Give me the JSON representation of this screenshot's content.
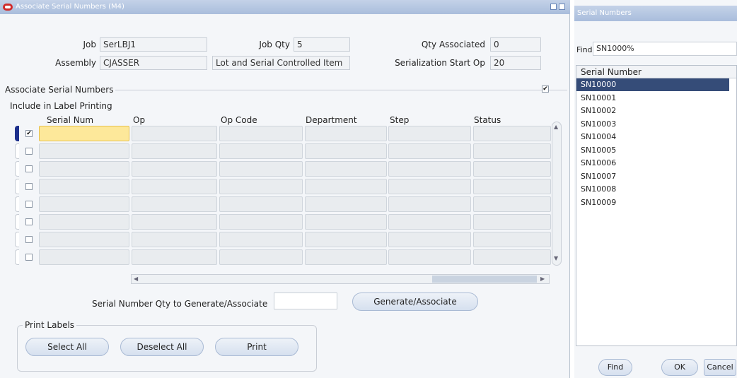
{
  "main_window": {
    "title": "Associate Serial Numbers (M4)",
    "header": {
      "job_label": "Job",
      "job_value": "SerLBJ1",
      "job_qty_label": "Job Qty",
      "job_qty_value": "5",
      "qty_associated_label": "Qty Associated",
      "qty_associated_value": "0",
      "assembly_label": "Assembly",
      "assembly_value": "CJASSER",
      "assembly_desc": "Lot and Serial Controlled Item",
      "serialization_label": "Serialization Start Op",
      "serialization_value": "20"
    },
    "section": {
      "title": "Associate Serial Numbers",
      "include_label": "Include in Label Printing",
      "columns": [
        "Serial Num",
        "Op",
        "Op Code",
        "Department",
        "Step",
        "Status"
      ],
      "rows": [
        {
          "checked": true,
          "cells": [
            "",
            "",
            "",
            "",
            "",
            ""
          ]
        },
        {
          "checked": false,
          "cells": [
            "",
            "",
            "",
            "",
            "",
            ""
          ]
        },
        {
          "checked": false,
          "cells": [
            "",
            "",
            "",
            "",
            "",
            ""
          ]
        },
        {
          "checked": false,
          "cells": [
            "",
            "",
            "",
            "",
            "",
            ""
          ]
        },
        {
          "checked": false,
          "cells": [
            "",
            "",
            "",
            "",
            "",
            ""
          ]
        },
        {
          "checked": false,
          "cells": [
            "",
            "",
            "",
            "",
            "",
            ""
          ]
        },
        {
          "checked": false,
          "cells": [
            "",
            "",
            "",
            "",
            "",
            ""
          ]
        },
        {
          "checked": false,
          "cells": [
            "",
            "",
            "",
            "",
            "",
            ""
          ]
        }
      ]
    },
    "generate": {
      "qty_label": "Serial Number Qty to Generate/Associate",
      "qty_value": "",
      "button": "Generate/Associate"
    },
    "print_labels": {
      "title": "Print Labels",
      "select_all": "Select All",
      "deselect_all": "Deselect All",
      "print": "Print"
    }
  },
  "serial_window": {
    "title": "Serial Numbers",
    "find_label": "Find",
    "find_value": "SN1000%",
    "list_header": "Serial Number",
    "items": [
      "SN10000",
      "SN10001",
      "SN10002",
      "SN10003",
      "SN10004",
      "SN10005",
      "SN10006",
      "SN10007",
      "SN10008",
      "SN10009"
    ],
    "selected_index": 0,
    "buttons": {
      "find": "Find",
      "ok": "OK",
      "cancel": "Cancel"
    }
  },
  "colors": {
    "accent": "#354c78",
    "active_cell": "#fde89a",
    "title_bar": "#b5c6e2"
  }
}
